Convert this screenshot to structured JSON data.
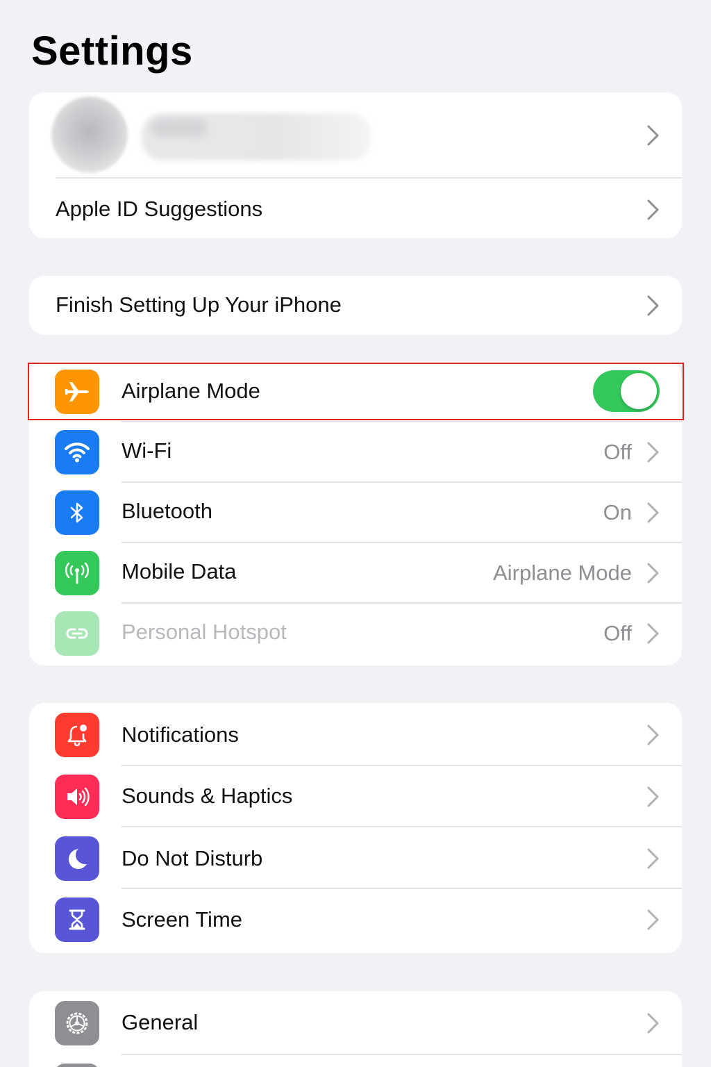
{
  "header": {
    "title": "Settings"
  },
  "account": {
    "suggestions_label": "Apple ID Suggestions"
  },
  "setup": {
    "label": "Finish Setting Up Your iPhone"
  },
  "connectivity": {
    "airplane_mode": {
      "label": "Airplane Mode",
      "toggle_on": true
    },
    "wifi": {
      "label": "Wi-Fi",
      "value": "Off"
    },
    "bluetooth": {
      "label": "Bluetooth",
      "value": "On"
    },
    "mobile_data": {
      "label": "Mobile Data",
      "value": "Airplane Mode"
    },
    "hotspot": {
      "label": "Personal Hotspot",
      "value": "Off"
    }
  },
  "alerts": {
    "notifications": {
      "label": "Notifications"
    },
    "sounds": {
      "label": "Sounds & Haptics"
    },
    "dnd": {
      "label": "Do Not Disturb"
    },
    "screen_time": {
      "label": "Screen Time"
    }
  },
  "system": {
    "general": {
      "label": "General"
    }
  },
  "colors": {
    "airplane": "#ff9500",
    "wifi": "#1a7cf2",
    "bluetooth": "#1a7cf2",
    "mobile_data": "#34c759",
    "hotspot": "#a8e6b6",
    "notifications": "#ff3b30",
    "sounds": "#ff2d55",
    "dnd": "#5856d6",
    "screen_time": "#5856d6",
    "general": "#8e8e93",
    "toggle_on": "#34c759",
    "highlight": "#e02424"
  }
}
